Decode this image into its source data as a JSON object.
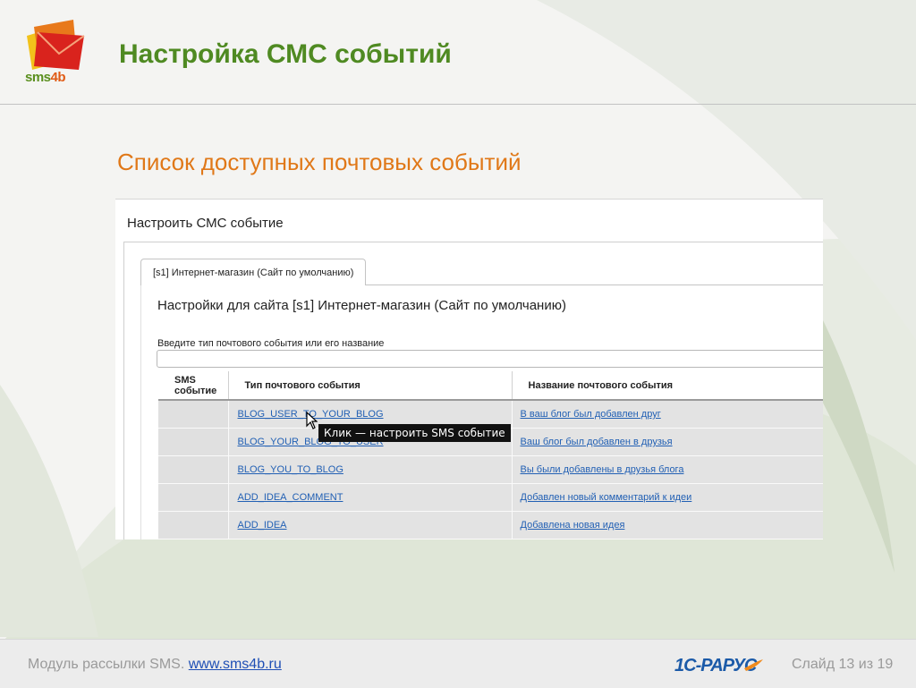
{
  "slide": {
    "title": "Настройка СМС событий",
    "subtitle": "Список доступных почтовых событий"
  },
  "logo": {
    "text_main": "sms",
    "text_accent": "4b"
  },
  "panel": {
    "title": "Настроить СМС событие",
    "tab_label": "[s1] Интернет-магазин (Сайт по умолчанию)",
    "settings_title": "Настройки для сайта [s1] Интернет-магазин (Сайт по умолчанию)",
    "field_label": "Введите тип почтового события или его название",
    "field_value": "",
    "table": {
      "headers": {
        "sms_line1": "SMS",
        "sms_line2": "событие",
        "type": "Тип почтового события",
        "name": "Название почтового события"
      },
      "rows": [
        {
          "type": "BLOG_USER_TO_YOUR_BLOG",
          "name": "В ваш блог был добавлен друг"
        },
        {
          "type": "BLOG_YOUR_BLOG_TO_USER",
          "name": "Ваш блог был добавлен в друзья"
        },
        {
          "type": "BLOG_YOU_TO_BLOG",
          "name": "Вы были добавлены в друзья блога"
        },
        {
          "type": "ADD_IDEA_COMMENT",
          "name": "Добавлен новый комментарий к идеи"
        },
        {
          "type": "ADD_IDEA",
          "name": "Добавлена новая идея"
        }
      ]
    },
    "tooltip": "Клик — настроить SMS событие"
  },
  "footer": {
    "module_text": "Модуль рассылки SMS.",
    "link_text": "www.sms4b.ru",
    "brand_name": "1С-Рарус",
    "slide_counter": "Слайд 13 из 19"
  },
  "colors": {
    "title_green": "#4f8a22",
    "subtitle_orange": "#e07818",
    "link_blue": "#2260b4",
    "row_bg": "#e3e3e3"
  },
  "icons": [
    "sms4b-envelope-logo-icon",
    "mouse-cursor-icon",
    "1c-rarus-logo-icon"
  ]
}
